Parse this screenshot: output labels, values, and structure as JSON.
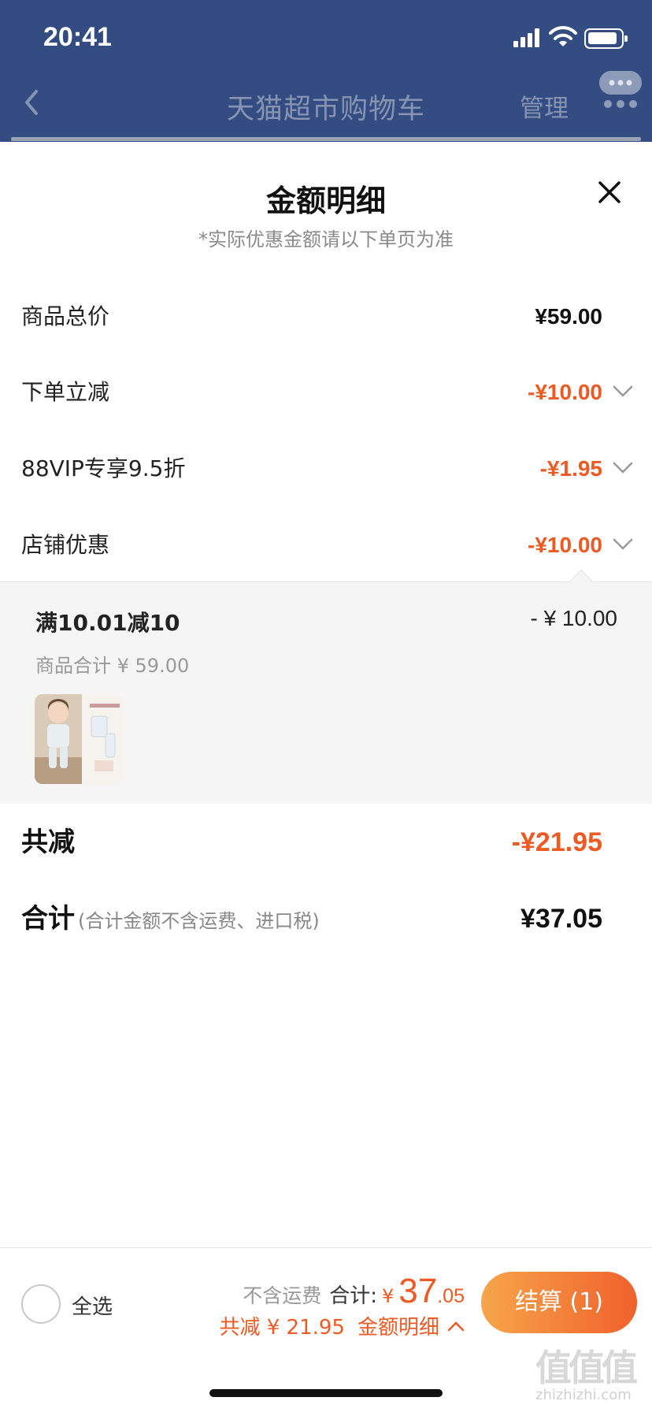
{
  "status_bar": {
    "time": "20:41"
  },
  "nav": {
    "title": "天猫超市购物车",
    "manage": "管理"
  },
  "sheet": {
    "title": "金额明细",
    "subtitle": "*实际优惠金额请以下单页为准",
    "rows": [
      {
        "label": "商品总价",
        "value": "¥59.00",
        "color": "#111111"
      },
      {
        "label": "下单立减",
        "value": "-¥10.00",
        "color": "#ef5a24",
        "expandable": true
      },
      {
        "label": "88VIP专享9.5折",
        "value": "-¥1.95",
        "color": "#ef5a24",
        "expandable": true
      },
      {
        "label": "店铺优惠",
        "value": "-¥10.00",
        "color": "#ef5a24",
        "expandable": true,
        "expanded": true
      }
    ],
    "promo": {
      "name": "满10.01减10",
      "amount": "- ¥ 10.00",
      "subtotal": "商品合计 ¥ 59.00"
    },
    "total_discount": {
      "label": "共减",
      "value": "-¥21.95"
    },
    "grand_total": {
      "label": "合计",
      "note": "(合计金额不含运费、进口税)",
      "value": "¥37.05"
    }
  },
  "bottom_bar": {
    "select_all": "全选",
    "no_shipping": "不含运费",
    "sum_label": "合计:",
    "currency": "¥",
    "price_int": "37",
    "price_dec": ".05",
    "discount": "共减 ¥ 21.95",
    "detail_link": "金额明细",
    "checkout": "结算 (1)"
  },
  "watermark": {
    "logo": "值值值",
    "text": "zhizhizhi.com"
  },
  "colors": {
    "header_bg": "#334d82",
    "accent": "#ef5a24"
  }
}
